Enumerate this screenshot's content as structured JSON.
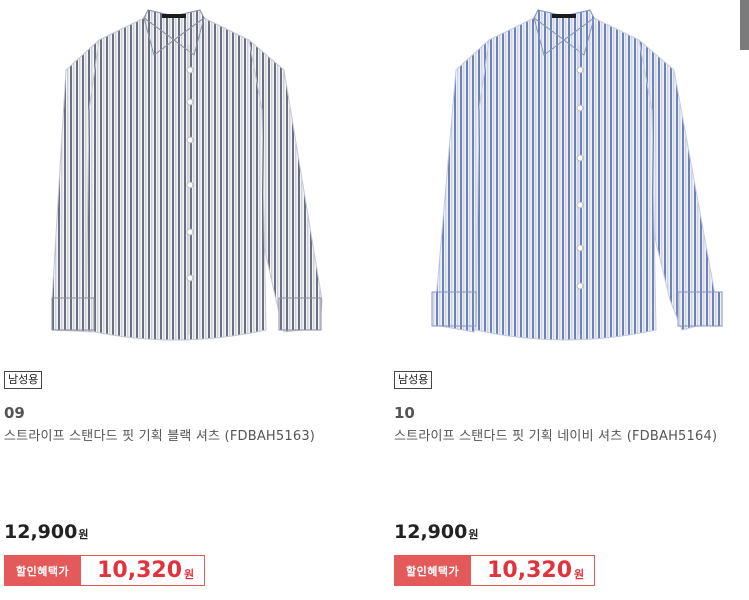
{
  "products": [
    {
      "tag": "남성용",
      "number": "09",
      "name": "스트라이프 스탠다드 핏 기획 블랙 셔츠 (FDBAH5163)",
      "price": "12,900",
      "currency": "원",
      "sale_label": "할인혜택가",
      "sale_price": "10,320",
      "shirt_icon": "striped-shirt-image",
      "shirt_color": "#f4f4f7",
      "stripe_color": "#6b6f82"
    },
    {
      "tag": "남성용",
      "number": "10",
      "name": "스트라이프 스탠다드 핏 기획 네이비 셔츠 (FDBAH5164)",
      "price": "12,900",
      "currency": "원",
      "sale_label": "할인혜택가",
      "sale_price": "10,320",
      "shirt_icon": "striped-shirt-image",
      "shirt_color": "#eef1f9",
      "stripe_color": "#6f82b8"
    }
  ],
  "colors": {
    "sale_accent": "#e45a5a",
    "sale_text": "#e0333d"
  }
}
